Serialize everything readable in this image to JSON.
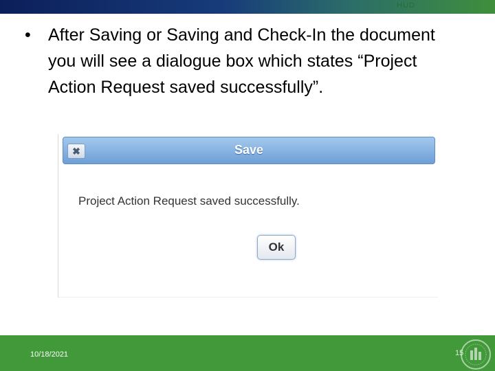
{
  "top_bar": {
    "label": "HUD"
  },
  "slide": {
    "bullet_symbol": "•",
    "bullet_text": "After Saving or Saving and Check-In the document you will see a dialogue box which states “Project Action Request saved successfully”."
  },
  "dialog": {
    "title": "Save",
    "close_icon": "close-icon",
    "close_glyph": "✖",
    "message": "Project Action Request saved successfully.",
    "ok_label": "Ok"
  },
  "footer": {
    "date": "10/18/2021",
    "page_number": "15",
    "logo": "hud-seal-icon"
  },
  "colors": {
    "top_bar": "#173b7a",
    "footer": "#41993a",
    "dialog_header": "#6d9fd6"
  }
}
